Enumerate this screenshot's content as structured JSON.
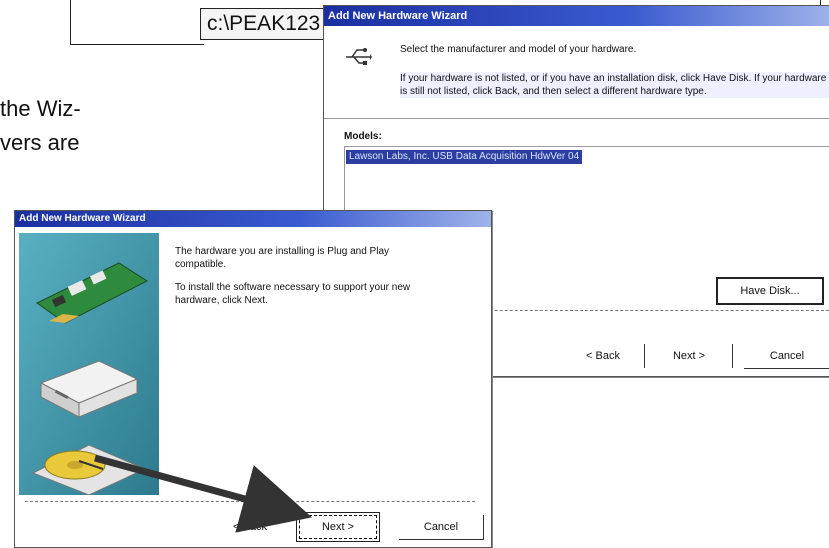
{
  "background": {
    "path_text": "c:\\PEAK123",
    "page_fragment_1": "the Wiz-",
    "page_fragment_2": "vers are"
  },
  "wizard_back": {
    "title": "Add New Hardware Wizard",
    "heading": "Select the manufacturer and model of your hardware.",
    "description": "If your hardware is not listed, or if you have an installation disk, click Have Disk. If your hardware is still not listed, click Back, and then select a different hardware type.",
    "models_label": "Models:",
    "selected_model": "Lawson Labs, Inc. USB Data Acquisition HdwVer 04",
    "have_disk_label": "Have Disk...",
    "back_label": "< Back",
    "next_label": "Next >",
    "cancel_label": "Cancel"
  },
  "wizard_front": {
    "title": "Add New Hardware Wizard",
    "line1": "The hardware you are installing is Plug and Play compatible.",
    "line2": "To install the software necessary to support your new hardware, click Next.",
    "back_label": "< Back",
    "next_label": "Next >",
    "cancel_label": "Cancel"
  },
  "colors": {
    "titlebar": "#1a2fa0",
    "arrow": "#333333",
    "selection": "#2c3fa0"
  }
}
